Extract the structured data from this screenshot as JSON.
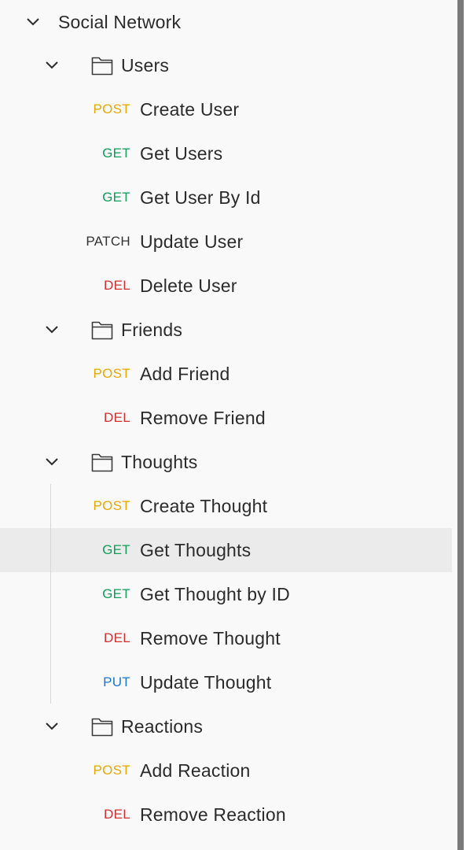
{
  "collection": {
    "name": "Social Network"
  },
  "folders": [
    {
      "name": "Users",
      "requests": [
        {
          "method": "POST",
          "name": "Create User"
        },
        {
          "method": "GET",
          "name": "Get Users"
        },
        {
          "method": "GET",
          "name": "Get User By Id"
        },
        {
          "method": "PATCH",
          "name": "Update User"
        },
        {
          "method": "DEL",
          "name": "Delete User"
        }
      ]
    },
    {
      "name": "Friends",
      "requests": [
        {
          "method": "POST",
          "name": "Add Friend"
        },
        {
          "method": "DEL",
          "name": "Remove Friend"
        }
      ]
    },
    {
      "name": "Thoughts",
      "requests": [
        {
          "method": "POST",
          "name": "Create Thought"
        },
        {
          "method": "GET",
          "name": "Get Thoughts"
        },
        {
          "method": "GET",
          "name": "Get Thought by ID"
        },
        {
          "method": "DEL",
          "name": "Remove Thought"
        },
        {
          "method": "PUT",
          "name": "Update Thought"
        }
      ]
    },
    {
      "name": "Reactions",
      "requests": [
        {
          "method": "POST",
          "name": "Add Reaction"
        },
        {
          "method": "DEL",
          "name": "Remove Reaction"
        }
      ]
    }
  ],
  "selected": "Get Thoughts",
  "colors": {
    "POST": "#e8a800",
    "GET": "#0f9d58",
    "PATCH": "#333333",
    "DEL": "#d32f2f",
    "PUT": "#1976d2",
    "selected_bg": "#ebebeb"
  },
  "icons": {
    "expand": "chevron-down-icon",
    "folder": "folder-icon"
  }
}
